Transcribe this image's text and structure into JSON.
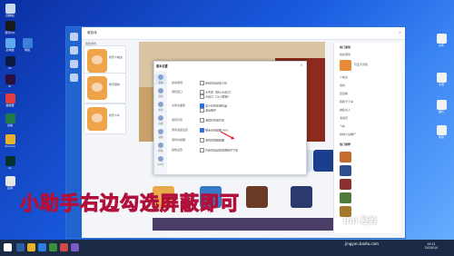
{
  "desktop": {
    "left_icons": [
      {
        "name": "recycle-bin",
        "label": "回收站",
        "color": "#ccd9ee"
      },
      {
        "name": "tencent-qq",
        "label": "腾讯QQ",
        "color": "#1a1a1a"
      },
      {
        "name": "this-pc",
        "label": "此电脑",
        "color": "#5fa8f0"
      },
      {
        "name": "network",
        "label": "网络",
        "color": "#3c7fd8"
      },
      {
        "name": "photoshop",
        "label": "Ps",
        "color": "#0b1a3c"
      },
      {
        "name": "premiere",
        "label": "Pr",
        "color": "#2a0f3d"
      },
      {
        "name": "media-player",
        "label": "播放器",
        "color": "#e23c3c"
      },
      {
        "name": "excel",
        "label": "表格",
        "color": "#1f7a45"
      },
      {
        "name": "chrome",
        "label": "Chrome",
        "color": "#e9b22c"
      },
      {
        "name": "audition",
        "label": "Au",
        "color": "#04322f"
      },
      {
        "name": "app-misc",
        "label": "应用",
        "color": "#e7e7e7"
      }
    ],
    "right_icons": [
      {
        "name": "file-a",
        "label": "文件",
        "color": "#f2f2f2"
      },
      {
        "name": "file-b",
        "label": "文档",
        "color": "#f2f2f2"
      },
      {
        "name": "file-c",
        "label": "图片",
        "color": "#f2f2f2"
      },
      {
        "name": "file-d",
        "label": "新建",
        "color": "#f2f2f2"
      }
    ]
  },
  "app": {
    "title": "微游戏",
    "section_label": "我的游戏",
    "cards": [
      {
        "label": "欢乐斗地主"
      },
      {
        "label": "欢乐麻将"
      },
      {
        "label": "欢乐斗牛"
      }
    ]
  },
  "dialog": {
    "title": "基本设置",
    "sidebar": [
      "基本",
      "消息",
      "游戏",
      "高级",
      "其他",
      "帮助",
      "QQ号"
    ],
    "rows": [
      {
        "label": "启动游戏",
        "option": "启动后自动最小化"
      },
      {
        "label": "游戏窗口",
        "option": "大字体（默认大窗口）"
      },
      {
        "label": "",
        "option": "大窗口（16:9屏幕）"
      },
      {
        "label": "关闭主面板",
        "option": "最小化到系统托盘"
      },
      {
        "label": "",
        "option": "退出程序"
      },
      {
        "label": "游戏声音",
        "option": "游戏时关闭声音"
      },
      {
        "label": "游戏进度设置",
        "option": "剩余时间提醒 40%"
      },
      {
        "label": "游戏中提醒",
        "option": "游戏时屏蔽提醒"
      },
      {
        "label": "其他设置",
        "option": "开启时自动检查更新并下载"
      }
    ],
    "fields": {
      "percent_value": "40%"
    }
  },
  "right_panel": {
    "title": "热门游戏",
    "items": [
      "我的游戏",
      "可爱大冒险",
      "斗地主",
      "麻将",
      "连连看",
      "跑跑卡丁车",
      "捕鱼达人",
      "消消乐",
      "飞车",
      "植物大战僵尸"
    ],
    "section2": "热门推荐"
  },
  "caption": "小助手右边勾选屏蔽即可",
  "watermark": {
    "brand": "Bai 经验",
    "url": "jingyan.baidu.com"
  },
  "taskbar": {
    "time": "19:21",
    "date": "2020/1/4"
  }
}
